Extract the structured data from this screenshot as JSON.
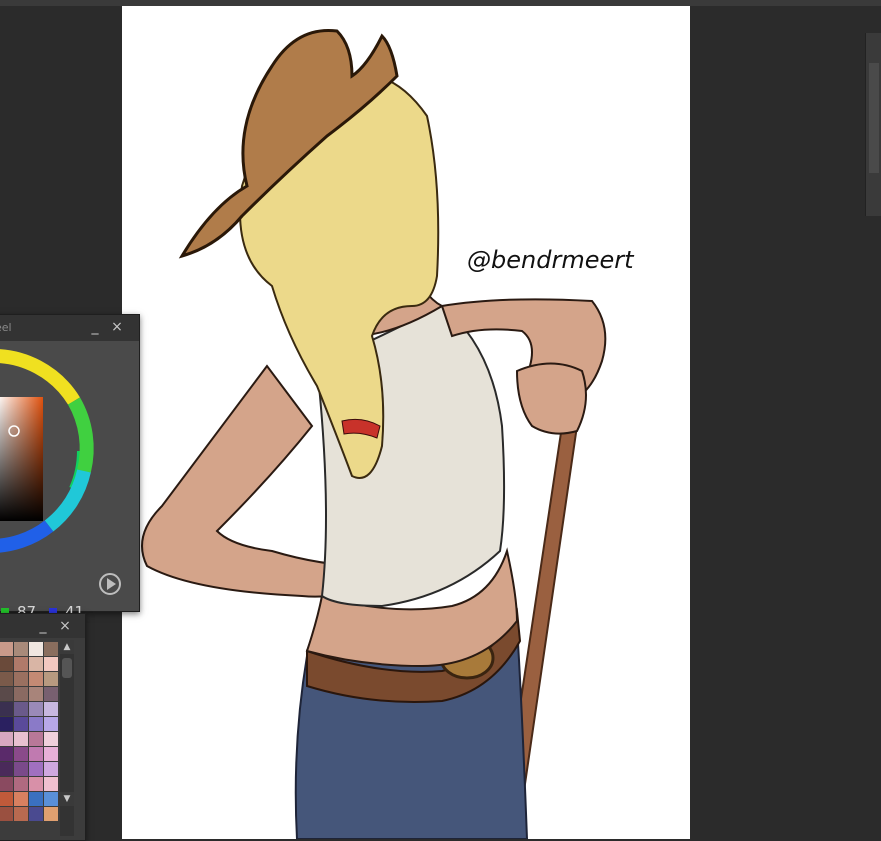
{
  "color_wheel_panel": {
    "title": "eel",
    "minimize_label": "_",
    "close_label": "×",
    "rgb": {
      "r": "",
      "g": "87",
      "b": "41"
    },
    "colors": {
      "g_swatch": "#22c02a",
      "b_swatch": "#2a32d8",
      "square_hue": "#e0520f"
    }
  },
  "palette_panel": {
    "minimize_label": "_",
    "close_label": "×",
    "scroll_up": "▲",
    "scroll_down": "▼",
    "swatches": [
      "#c99a8a",
      "#a88a7a",
      "#f0e6e0",
      "#8a6e5e",
      "#6a4a3a",
      "#b07a6a",
      "#d9b5a5",
      "#f2c8c0",
      "#7a5a4a",
      "#9a7060",
      "#c48a74",
      "#b89a80",
      "#5a4a4a",
      "#8a6a62",
      "#a8847a",
      "#786070",
      "#3a3050",
      "#6a5a8a",
      "#9a8ab8",
      "#c8b8e0",
      "#2a2060",
      "#5a4a9a",
      "#8a7ac8",
      "#b8a8e8",
      "#d8a8c0",
      "#e8c0d0",
      "#b87898",
      "#f0d0dc",
      "#5a2a6a",
      "#8a4a8a",
      "#c07ab0",
      "#e8b0d8",
      "#4a2a5a",
      "#7a4a8a",
      "#a070c0",
      "#d0a8e0",
      "#8a4a60",
      "#b06a80",
      "#d890a8",
      "#f0c0d0",
      "#c05a3a",
      "#d88060",
      "#3a70c0",
      "#5a90d8",
      "#9a5040",
      "#b86a50",
      "#4a4a90",
      "#e0a070"
    ]
  },
  "artwork": {
    "signature": "@bendrmeert",
    "colors": {
      "hat": "#b07c4a",
      "hair": "#ecd98a",
      "skin": "#d4a48a",
      "tank": "#e6e2d8",
      "jeans": "#45567a",
      "belt": "#7a4a2e",
      "pole": "#9a6040",
      "ribbon": "#c8322a"
    }
  }
}
